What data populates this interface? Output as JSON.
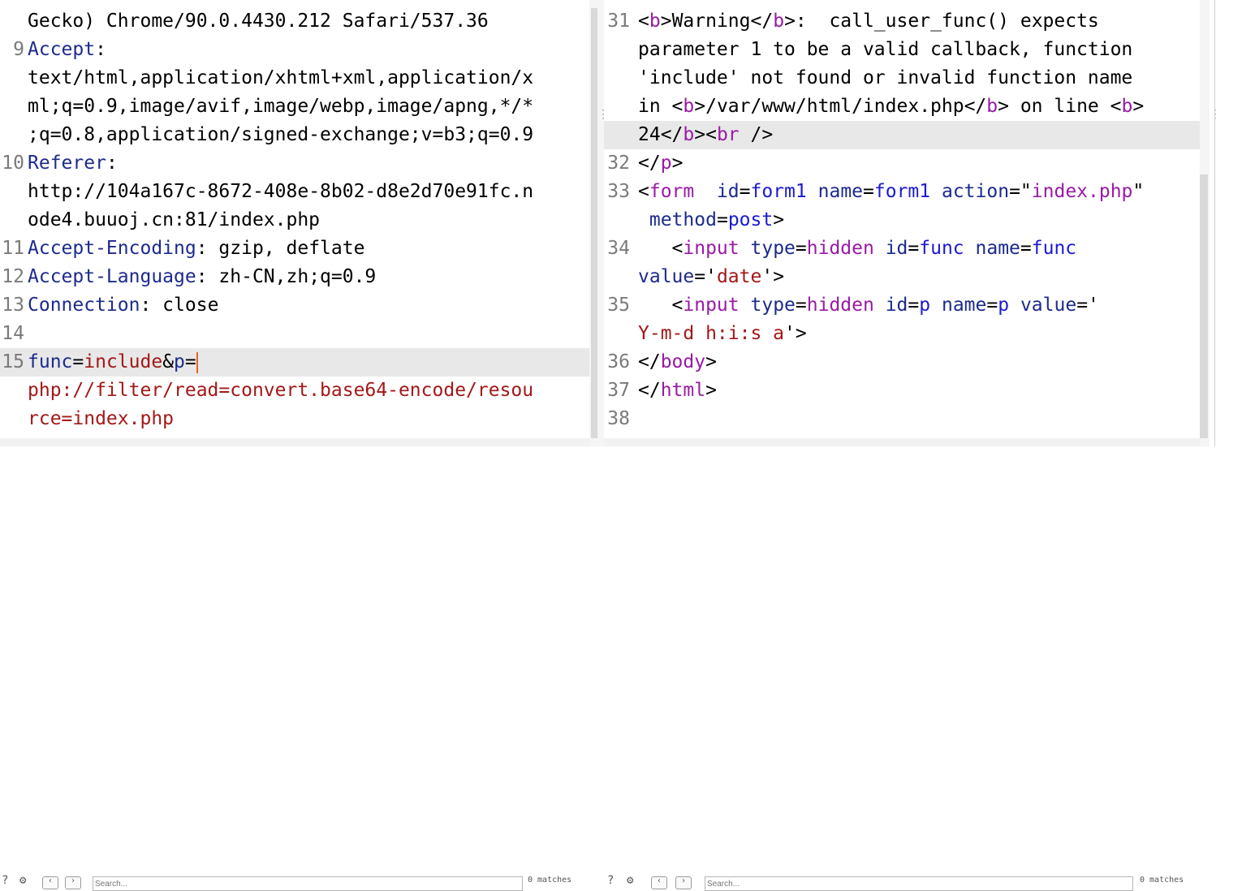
{
  "request": {
    "lines": [
      {
        "num": "",
        "parts": [
          {
            "t": "Gecko) Chrome/90.0.4430.212 Safari/537.36",
            "c": "t"
          }
        ]
      },
      {
        "num": "9",
        "parts": [
          {
            "t": "Accept",
            "c": "k"
          },
          {
            "t": ":",
            "c": "t"
          }
        ]
      },
      {
        "num": "",
        "parts": [
          {
            "t": "text/html,application/xhtml+xml,application/x",
            "c": "t"
          }
        ]
      },
      {
        "num": "",
        "parts": [
          {
            "t": "ml;q=0.9,image/avif,image/webp,image/apng,*/*",
            "c": "t"
          }
        ]
      },
      {
        "num": "",
        "parts": [
          {
            "t": ";q=0.8,application/signed-exchange;v=b3;q=0.9",
            "c": "t"
          }
        ]
      },
      {
        "num": "10",
        "parts": [
          {
            "t": "Referer",
            "c": "k"
          },
          {
            "t": ":",
            "c": "t"
          }
        ]
      },
      {
        "num": "",
        "parts": [
          {
            "t": "http://104a167c-8672-408e-8b02-d8e2d70e91fc.n",
            "c": "t"
          }
        ]
      },
      {
        "num": "",
        "parts": [
          {
            "t": "ode4.buuoj.cn:81/index.php",
            "c": "t"
          }
        ]
      },
      {
        "num": "11",
        "parts": [
          {
            "t": "Accept-Encoding",
            "c": "k"
          },
          {
            "t": ": gzip, deflate",
            "c": "t"
          }
        ]
      },
      {
        "num": "12",
        "parts": [
          {
            "t": "Accept-Language",
            "c": "k"
          },
          {
            "t": ": zh-CN,zh;q=0.9",
            "c": "t"
          }
        ]
      },
      {
        "num": "13",
        "parts": [
          {
            "t": "Connection",
            "c": "k"
          },
          {
            "t": ": close",
            "c": "t"
          }
        ]
      },
      {
        "num": "14",
        "parts": []
      },
      {
        "num": "15",
        "hl": true,
        "cursor": true,
        "parts": [
          {
            "t": "func",
            "c": "k"
          },
          {
            "t": "=",
            "c": "t"
          },
          {
            "t": "include",
            "c": "v"
          },
          {
            "t": "&",
            "c": "t"
          },
          {
            "t": "p",
            "c": "k"
          },
          {
            "t": "=",
            "c": "t"
          }
        ]
      },
      {
        "num": "",
        "parts": [
          {
            "t": "php://filter/read=convert.base64-encode/resou",
            "c": "v"
          }
        ]
      },
      {
        "num": "",
        "parts": [
          {
            "t": "rce=index.php",
            "c": "v"
          }
        ]
      }
    ]
  },
  "response": {
    "lines": [
      {
        "num": "31",
        "parts": [
          {
            "t": "<",
            "c": "t"
          },
          {
            "t": "b",
            "c": "tb"
          },
          {
            "t": ">Warning</",
            "c": "t"
          },
          {
            "t": "b",
            "c": "tb"
          },
          {
            "t": ">:  call_user_func() expects",
            "c": "t"
          }
        ]
      },
      {
        "num": "",
        "parts": [
          {
            "t": "parameter 1 to be a valid callback, function",
            "c": "t"
          }
        ]
      },
      {
        "num": "",
        "parts": [
          {
            "t": "'include' not found or invalid function name",
            "c": "t"
          }
        ]
      },
      {
        "num": "",
        "parts": [
          {
            "t": "in <",
            "c": "t"
          },
          {
            "t": "b",
            "c": "tb"
          },
          {
            "t": ">/var/www/html/index.php</",
            "c": "t"
          },
          {
            "t": "b",
            "c": "tb"
          },
          {
            "t": "> on line <",
            "c": "t"
          },
          {
            "t": "b",
            "c": "tb"
          },
          {
            "t": ">",
            "c": "t"
          }
        ]
      },
      {
        "num": "",
        "hl": true,
        "parts": [
          {
            "t": "24</",
            "c": "t"
          },
          {
            "t": "b",
            "c": "tb"
          },
          {
            "t": "><",
            "c": "t"
          },
          {
            "t": "br",
            "c": "tb"
          },
          {
            "t": " />",
            "c": "t"
          }
        ]
      },
      {
        "num": "32",
        "parts": [
          {
            "t": "</",
            "c": "t"
          },
          {
            "t": "p",
            "c": "tb"
          },
          {
            "t": ">",
            "c": "t"
          }
        ]
      },
      {
        "num": "33",
        "parts": [
          {
            "t": "<",
            "c": "t"
          },
          {
            "t": "form",
            "c": "tb"
          },
          {
            "t": "  ",
            "c": "t"
          },
          {
            "t": "id",
            "c": "at"
          },
          {
            "t": "=",
            "c": "t"
          },
          {
            "t": "form1",
            "c": "tg"
          },
          {
            "t": " ",
            "c": "t"
          },
          {
            "t": "name",
            "c": "at"
          },
          {
            "t": "=",
            "c": "t"
          },
          {
            "t": "form1",
            "c": "tg"
          },
          {
            "t": " ",
            "c": "t"
          },
          {
            "t": "action",
            "c": "at"
          },
          {
            "t": "=\"",
            "c": "t"
          },
          {
            "t": "index.php",
            "c": "tb"
          },
          {
            "t": "\"",
            "c": "t"
          }
        ]
      },
      {
        "num": "",
        "parts": [
          {
            "t": " ",
            "c": "t"
          },
          {
            "t": "method",
            "c": "at"
          },
          {
            "t": "=",
            "c": "t"
          },
          {
            "t": "post",
            "c": "tg"
          },
          {
            "t": ">",
            "c": "t"
          }
        ]
      },
      {
        "num": "34",
        "parts": [
          {
            "t": "   <",
            "c": "t"
          },
          {
            "t": "input",
            "c": "tb"
          },
          {
            "t": " ",
            "c": "t"
          },
          {
            "t": "type",
            "c": "at"
          },
          {
            "t": "=",
            "c": "t"
          },
          {
            "t": "hidden",
            "c": "tb"
          },
          {
            "t": " ",
            "c": "t"
          },
          {
            "t": "id",
            "c": "at"
          },
          {
            "t": "=",
            "c": "t"
          },
          {
            "t": "func",
            "c": "tg"
          },
          {
            "t": " ",
            "c": "t"
          },
          {
            "t": "name",
            "c": "at"
          },
          {
            "t": "=",
            "c": "t"
          },
          {
            "t": "func",
            "c": "tg"
          }
        ]
      },
      {
        "num": "",
        "parts": [
          {
            "t": "value",
            "c": "at"
          },
          {
            "t": "='",
            "c": "t"
          },
          {
            "t": "date",
            "c": "v"
          },
          {
            "t": "'>",
            "c": "t"
          }
        ]
      },
      {
        "num": "35",
        "parts": [
          {
            "t": "   <",
            "c": "t"
          },
          {
            "t": "input",
            "c": "tb"
          },
          {
            "t": " ",
            "c": "t"
          },
          {
            "t": "type",
            "c": "at"
          },
          {
            "t": "=",
            "c": "t"
          },
          {
            "t": "hidden",
            "c": "tb"
          },
          {
            "t": " ",
            "c": "t"
          },
          {
            "t": "id",
            "c": "at"
          },
          {
            "t": "=",
            "c": "t"
          },
          {
            "t": "p",
            "c": "tg"
          },
          {
            "t": " ",
            "c": "t"
          },
          {
            "t": "name",
            "c": "at"
          },
          {
            "t": "=",
            "c": "t"
          },
          {
            "t": "p",
            "c": "tg"
          },
          {
            "t": " ",
            "c": "t"
          },
          {
            "t": "value",
            "c": "at"
          },
          {
            "t": "='",
            "c": "t"
          }
        ]
      },
      {
        "num": "",
        "parts": [
          {
            "t": "Y-m-d h:i:s a",
            "c": "v"
          },
          {
            "t": "'>",
            "c": "t"
          }
        ]
      },
      {
        "num": "36",
        "parts": [
          {
            "t": "</",
            "c": "t"
          },
          {
            "t": "body",
            "c": "tb"
          },
          {
            "t": ">",
            "c": "t"
          }
        ]
      },
      {
        "num": "37",
        "parts": [
          {
            "t": "</",
            "c": "t"
          },
          {
            "t": "html",
            "c": "tb"
          },
          {
            "t": ">",
            "c": "t"
          }
        ]
      },
      {
        "num": "38",
        "parts": []
      }
    ]
  },
  "footer": {
    "left_search_placeholder": "Search...",
    "right_search_placeholder": "Search...",
    "left_matches": "0 matches",
    "right_matches": "0 matches"
  },
  "icons": [
    "help-icon",
    "settings-icon",
    "prev-icon",
    "next-icon"
  ]
}
